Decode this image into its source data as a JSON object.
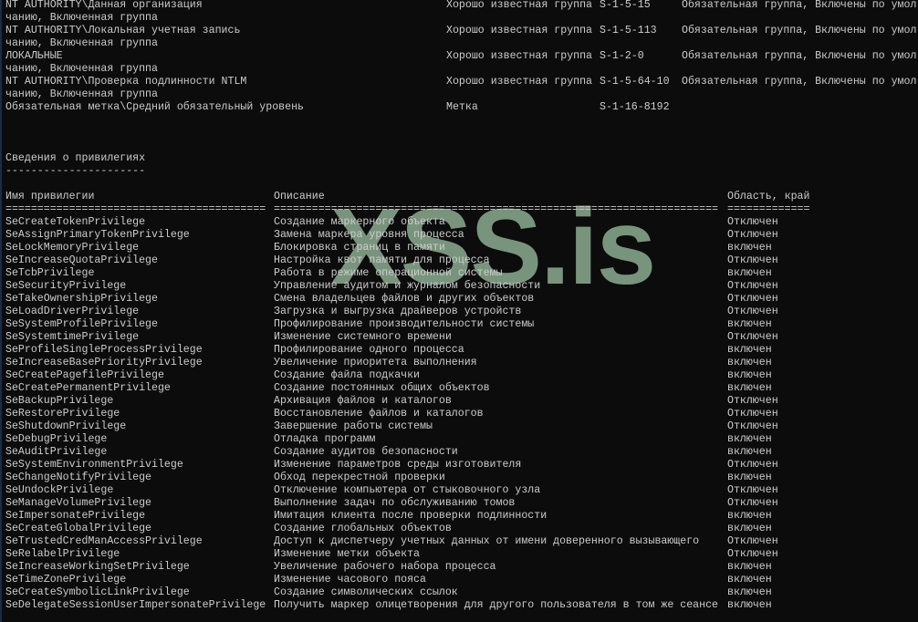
{
  "watermark": "XSS.is",
  "groups": [
    {
      "name": "NT AUTHORITY\\Данная организация",
      "type": "Хорошо известная группа",
      "sid": "S-1-5-15",
      "attrs": "Обязательная группа, Включены по умол",
      "cont": "чанию, Включенная группа"
    },
    {
      "name": "NT AUTHORITY\\Локальная учетная запись",
      "type": "Хорошо известная группа",
      "sid": "S-1-5-113",
      "attrs": "Обязательная группа, Включены по умол",
      "cont": "чанию, Включенная группа"
    },
    {
      "name": "ЛОКАЛЬНЫЕ",
      "type": "Хорошо известная группа",
      "sid": "S-1-2-0",
      "attrs": "Обязательная группа, Включены по умол",
      "cont": "чанию, Включенная группа"
    },
    {
      "name": "NT AUTHORITY\\Проверка подлинности NTLM",
      "type": "Хорошо известная группа",
      "sid": "S-1-5-64-10",
      "attrs": "Обязательная группа, Включены по умол",
      "cont": "чанию, Включенная группа"
    },
    {
      "name": "Обязательная метка\\Средний обязательный уровень",
      "type": "Метка",
      "sid": "S-1-16-8192",
      "attrs": "",
      "cont": null
    }
  ],
  "privileges_section": {
    "title": "Сведения о привилегиях",
    "underline": "----------------------",
    "headers": {
      "name": "Имя привилегии",
      "description": "Описание",
      "state": "Область, край"
    },
    "separators": {
      "name": "=========================================",
      "description": "======================================================================",
      "state": "============="
    },
    "rows": [
      [
        "SeCreateTokenPrivilege",
        "Создание маркерного объекта",
        "Отключен"
      ],
      [
        "SeAssignPrimaryTokenPrivilege",
        "Замена маркера уровня процесса",
        "Отключен"
      ],
      [
        "SeLockMemoryPrivilege",
        "Блокировка страниц в памяти",
        "включен"
      ],
      [
        "SeIncreaseQuotaPrivilege",
        "Настройка квот памяти для процесса",
        "Отключен"
      ],
      [
        "SeTcbPrivilege",
        "Работа в режиме операционной системы",
        "включен"
      ],
      [
        "SeSecurityPrivilege",
        "Управление аудитом и журналом безопасности",
        "Отключен"
      ],
      [
        "SeTakeOwnershipPrivilege",
        "Смена владельцев файлов и других объектов",
        "Отключен"
      ],
      [
        "SeLoadDriverPrivilege",
        "Загрузка и выгрузка драйверов устройств",
        "Отключен"
      ],
      [
        "SeSystemProfilePrivilege",
        "Профилирование производительности системы",
        "включен"
      ],
      [
        "SeSystemtimePrivilege",
        "Изменение системного времени",
        "Отключен"
      ],
      [
        "SeProfileSingleProcessPrivilege",
        "Профилирование одного процесса",
        "включен"
      ],
      [
        "SeIncreaseBasePriorityPrivilege",
        "Увеличение приоритета выполнения",
        "включен"
      ],
      [
        "SeCreatePagefilePrivilege",
        "Создание файла подкачки",
        "включен"
      ],
      [
        "SeCreatePermanentPrivilege",
        "Создание постоянных общих объектов",
        "включен"
      ],
      [
        "SeBackupPrivilege",
        "Архивация файлов и каталогов",
        "Отключен"
      ],
      [
        "SeRestorePrivilege",
        "Восстановление файлов и каталогов",
        "Отключен"
      ],
      [
        "SeShutdownPrivilege",
        "Завершение работы системы",
        "Отключен"
      ],
      [
        "SeDebugPrivilege",
        "Отладка программ",
        "включен"
      ],
      [
        "SeAuditPrivilege",
        "Создание аудитов безопасности",
        "включен"
      ],
      [
        "SeSystemEnvironmentPrivilege",
        "Изменение параметров среды изготовителя",
        "Отключен"
      ],
      [
        "SeChangeNotifyPrivilege",
        "Обход перекрестной проверки",
        "включен"
      ],
      [
        "SeUndockPrivilege",
        "Отключение компьютера от стыковочного узла",
        "Отключен"
      ],
      [
        "SeManageVolumePrivilege",
        "Выполнение задач по обслуживанию томов",
        "Отключен"
      ],
      [
        "SeImpersonatePrivilege",
        "Имитация клиента после проверки подлинности",
        "включен"
      ],
      [
        "SeCreateGlobalPrivilege",
        "Создание глобальных объектов",
        "включен"
      ],
      [
        "SeTrustedCredManAccessPrivilege",
        "Доступ к диспетчеру учетных данных от имени доверенного вызывающего",
        "Отключен"
      ],
      [
        "SeRelabelPrivilege",
        "Изменение метки объекта",
        "Отключен"
      ],
      [
        "SeIncreaseWorkingSetPrivilege",
        "Увеличение рабочего набора процесса",
        "включен"
      ],
      [
        "SeTimeZonePrivilege",
        "Изменение часового пояса",
        "включен"
      ],
      [
        "SeCreateSymbolicLinkPrivilege",
        "Создание символических ссылок",
        "включен"
      ],
      [
        "SeDelegateSessionUserImpersonatePrivilege",
        "Получить маркер олицетворения для другого пользователя в том же сеансе",
        "включен"
      ]
    ]
  }
}
